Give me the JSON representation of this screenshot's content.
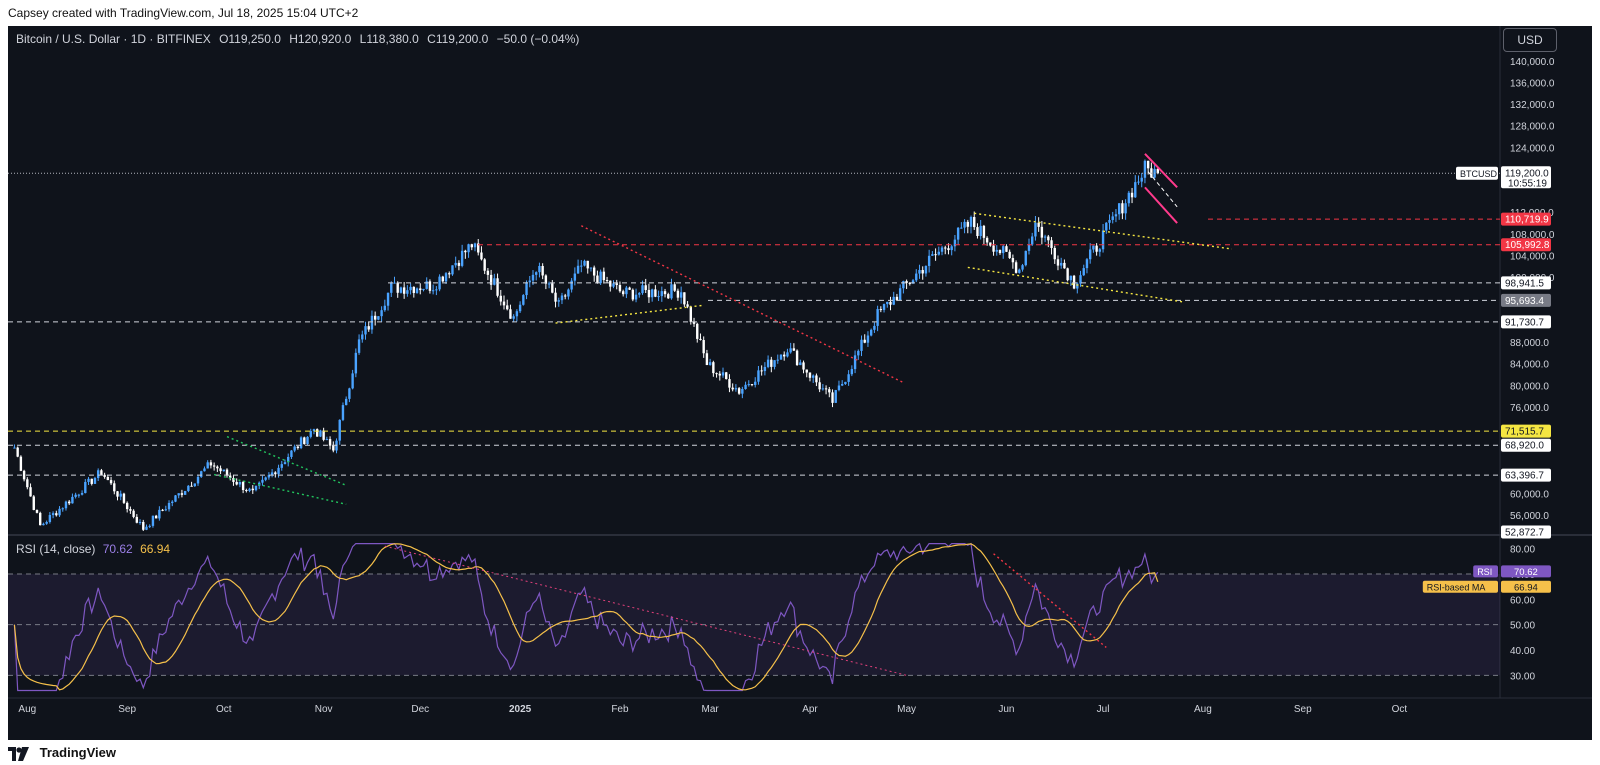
{
  "top_caption": "Capsey created with TradingView.com, Jul 18, 2025 15:04 UTC+2",
  "header": {
    "symbol": "Bitcoin / U.S. Dollar · 1D · BITFINEX",
    "open": "O119,250.0",
    "high": "H120,920.0",
    "low": "L118,380.0",
    "close": "C119,200.0",
    "change": "−50.0 (−0.04%)"
  },
  "currency_button": "USD",
  "rsi_header": {
    "label": "RSI (14, close)",
    "rsi_value": "70.62",
    "ma_value": "66.94"
  },
  "footer_brand": "TradingView",
  "colors": {
    "background": "#0f131b",
    "candle_up": "#4aa3ff",
    "candle_down": "#ffffff",
    "resistance_red": "#f23645",
    "support_yellow": "#f5e642",
    "rsi_line": "#7e57c2",
    "rsi_ma": "#f5c04a",
    "pink": "#ff3a8c"
  },
  "chart_data": [
    {
      "type": "candlestick",
      "title": "Bitcoin / U.S. Dollar · 1D · BITFINEX",
      "x_ticks": [
        "Aug",
        "Sep",
        "Oct",
        "Nov",
        "Dec",
        "2025",
        "Feb",
        "Mar",
        "Apr",
        "May",
        "Jun",
        "Jul",
        "Aug",
        "Sep",
        "Oct"
      ],
      "y_ticks": [
        140000,
        136000,
        132000,
        128000,
        124000,
        112000,
        108000,
        104000,
        100000,
        88000,
        84000,
        80000,
        76000,
        60000,
        56000
      ],
      "y_tick_labels": [
        "140,000.0",
        "136,000.0",
        "132,000.0",
        "128,000.0",
        "124,000.0",
        "112,000.0",
        "108,000.0",
        "104,000.0",
        "100,000.0",
        "88,000.0",
        "84,000.0",
        "80,000.0",
        "76,000.0",
        "60,000.0",
        "56,000.0"
      ],
      "y_range": [
        52500,
        142000
      ],
      "price_labels": [
        {
          "value": 119200,
          "text": "119,200.0",
          "sub": "10:55:19",
          "tag": "BTCUSD",
          "style": "white"
        },
        {
          "value": 110719.9,
          "text": "110,719.9",
          "style": "red"
        },
        {
          "value": 105992.8,
          "text": "105,992.8",
          "style": "red"
        },
        {
          "value": 98941.5,
          "text": "98,941.5",
          "style": "white"
        },
        {
          "value": 95693.4,
          "text": "95,693.4",
          "style": "grey"
        },
        {
          "value": 91730.7,
          "text": "91,730.7",
          "style": "white"
        },
        {
          "value": 71515.7,
          "text": "71,515.7",
          "style": "yellow"
        },
        {
          "value": 68920.0,
          "text": "68,920.0",
          "style": "white"
        },
        {
          "value": 63396.7,
          "text": "63,396.7",
          "style": "white"
        },
        {
          "value": 52872.7,
          "text": "52,872.7",
          "style": "white"
        }
      ],
      "series": [
        {
          "name": "BTCUSD daily close (approx.)",
          "points": [
            {
              "date": "2024-07-28",
              "close": 68500
            },
            {
              "date": "2024-08-05",
              "close": 54000
            },
            {
              "date": "2024-08-24",
              "close": 64000
            },
            {
              "date": "2024-09-06",
              "close": 53500
            },
            {
              "date": "2024-09-27",
              "close": 65500
            },
            {
              "date": "2024-10-10",
              "close": 60000
            },
            {
              "date": "2024-10-29",
              "close": 72000
            },
            {
              "date": "2024-11-04",
              "close": 68000
            },
            {
              "date": "2024-11-12",
              "close": 88000
            },
            {
              "date": "2024-11-22",
              "close": 98000
            },
            {
              "date": "2024-12-05",
              "close": 98500
            },
            {
              "date": "2024-12-17",
              "close": 106000
            },
            {
              "date": "2024-12-30",
              "close": 92500
            },
            {
              "date": "2025-01-06",
              "close": 102000
            },
            {
              "date": "2025-01-13",
              "close": 94500
            },
            {
              "date": "2025-01-20",
              "close": 102000
            },
            {
              "date": "2025-02-02",
              "close": 97000
            },
            {
              "date": "2025-02-20",
              "close": 97500
            },
            {
              "date": "2025-02-28",
              "close": 84000
            },
            {
              "date": "2025-03-10",
              "close": 79000
            },
            {
              "date": "2025-03-25",
              "close": 87000
            },
            {
              "date": "2025-04-08",
              "close": 77000
            },
            {
              "date": "2025-04-22",
              "close": 93000
            },
            {
              "date": "2025-05-08",
              "close": 103000
            },
            {
              "date": "2025-05-21",
              "close": 110000
            },
            {
              "date": "2025-06-05",
              "close": 101500
            },
            {
              "date": "2025-06-10",
              "close": 110000
            },
            {
              "date": "2025-06-22",
              "close": 99000
            },
            {
              "date": "2025-07-03",
              "close": 109500
            },
            {
              "date": "2025-07-14",
              "close": 120000
            },
            {
              "date": "2025-07-18",
              "close": 119200
            }
          ]
        }
      ]
    },
    {
      "type": "line",
      "title": "RSI (14, close)",
      "y_ticks": [
        80,
        70,
        60,
        50,
        40,
        30
      ],
      "y_tick_labels": [
        "80.00",
        "70.00",
        "60.00",
        "50.00",
        "40.00",
        "30.00"
      ],
      "y_range": [
        25,
        85
      ],
      "bands": [
        70,
        50,
        30
      ],
      "series": [
        {
          "name": "RSI",
          "last": 70.62
        },
        {
          "name": "RSI-based MA",
          "last": 66.94
        }
      ],
      "labels": [
        {
          "tag": "RSI",
          "text": "70.62"
        },
        {
          "tag": "RSI-based MA",
          "text": "66.94"
        }
      ]
    }
  ]
}
